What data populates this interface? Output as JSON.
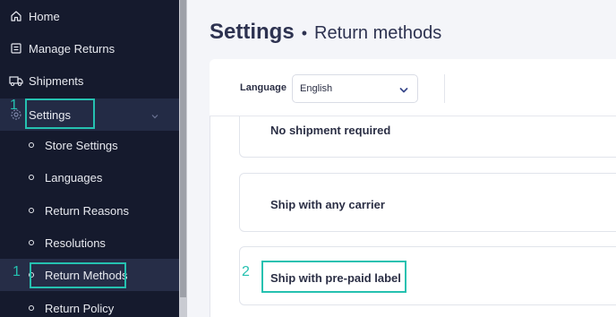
{
  "sidebar": {
    "items": [
      {
        "label": "Home",
        "icon": "home-icon"
      },
      {
        "label": "Manage Returns",
        "icon": "returns-icon"
      },
      {
        "label": "Shipments",
        "icon": "truck-icon"
      },
      {
        "label": "Settings",
        "icon": "gear-icon"
      }
    ],
    "sub_items": [
      {
        "label": "Store Settings"
      },
      {
        "label": "Languages"
      },
      {
        "label": "Return Reasons"
      },
      {
        "label": "Resolutions"
      },
      {
        "label": "Return Methods"
      },
      {
        "label": "Return Policy"
      }
    ]
  },
  "annotations": {
    "settings_num": "1",
    "return_methods_num": "1",
    "prepaid_num": "2",
    "color": "#25c1b0"
  },
  "header": {
    "title": "Settings",
    "separator": "•",
    "subtitle": "Return methods"
  },
  "language": {
    "label": "Language",
    "selected": "English"
  },
  "methods": [
    {
      "label": "No shipment required"
    },
    {
      "label": "Ship with any carrier"
    },
    {
      "label": "Ship with pre-paid label"
    }
  ],
  "colors": {
    "sidebar_bg": "#151a2d",
    "active_bg": "#232b45",
    "accent": "#25c1b0",
    "title": "#2d3250"
  }
}
